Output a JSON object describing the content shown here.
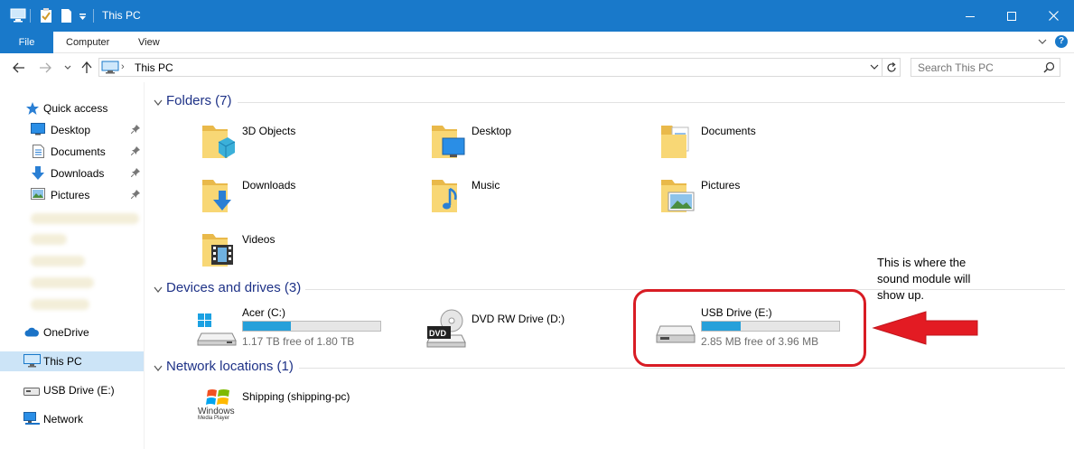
{
  "window": {
    "title": "This PC"
  },
  "ribbon": {
    "tabs": [
      "File",
      "Computer",
      "View"
    ],
    "help_label": "?"
  },
  "address": {
    "crumb_sep": "›",
    "crumb": "This PC"
  },
  "search": {
    "placeholder": "Search This PC"
  },
  "sidebar": {
    "quick_access": "Quick access",
    "pinned": [
      "Desktop",
      "Documents",
      "Downloads",
      "Pictures"
    ],
    "onedrive": "OneDrive",
    "this_pc": "This PC",
    "usb": "USB Drive (E:)",
    "network": "Network"
  },
  "groups": {
    "folders": "Folders (7)",
    "devices": "Devices and drives (3)",
    "network": "Network locations (1)"
  },
  "folders": [
    "3D Objects",
    "Desktop",
    "Documents",
    "Downloads",
    "Music",
    "Pictures",
    "Videos"
  ],
  "drives": [
    {
      "name": "Acer (C:)",
      "free_text": "1.17 TB free of 1.80 TB",
      "used_fraction": 0.35
    },
    {
      "name": "DVD RW Drive (D:)"
    },
    {
      "name": "USB Drive (E:)",
      "free_text": "2.85 MB free of 3.96 MB",
      "used_fraction": 0.28
    }
  ],
  "network_location": {
    "name": "Shipping (shipping-pc)",
    "icon_text_1": "Windows",
    "icon_text_2": "Media Player"
  },
  "dvd_badge": "DVD",
  "annotation": {
    "lines": [
      "This is where the",
      "sound module will",
      "show up."
    ]
  },
  "colors": {
    "accent": "#1979ca",
    "progress": "#26a0da",
    "annotation_red": "#d81c24",
    "group_header": "#1e3287"
  }
}
